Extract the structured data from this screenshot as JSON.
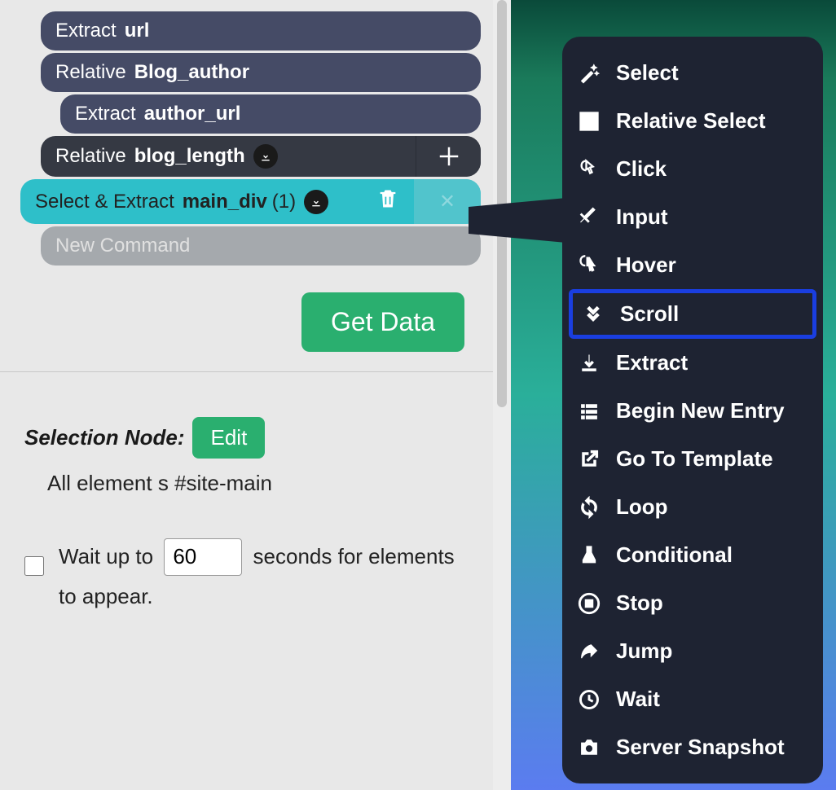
{
  "commands": {
    "extract_url": {
      "type": "Extract",
      "name": "url"
    },
    "relative_author": {
      "type": "Relative",
      "name": "Blog_author"
    },
    "extract_author_url": {
      "type": "Extract",
      "name": "author_url"
    },
    "relative_blog_length": {
      "type": "Relative",
      "name": "blog_length"
    },
    "select_extract_main": {
      "type": "Select & Extract",
      "name": "main_div",
      "count": "(1)"
    },
    "new_command_placeholder": "New Command"
  },
  "buttons": {
    "get_data": "Get Data",
    "edit": "Edit"
  },
  "selection": {
    "label": "Selection Node:",
    "selector_text": "All element s #site-main",
    "wait_prefix": "Wait up to ",
    "wait_value": "60",
    "wait_middle": " seconds for elements",
    "wait_suffix": "to appear."
  },
  "menu": {
    "select": "Select",
    "relative_select": "Relative Select",
    "click": "Click",
    "input": "Input",
    "hover": "Hover",
    "scroll": "Scroll",
    "extract": "Extract",
    "begin_new_entry": "Begin New Entry",
    "go_to_template": "Go To Template",
    "loop": "Loop",
    "conditional": "Conditional",
    "stop": "Stop",
    "jump": "Jump",
    "wait": "Wait",
    "server_snapshot": "Server Snapshot"
  }
}
